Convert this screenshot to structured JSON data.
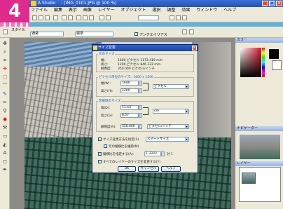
{
  "step": {
    "number": "4"
  },
  "app": {
    "title": "A Studio　 - [IMG_0101.JPG @ 100 %]"
  },
  "menu": [
    "ファイル",
    "編集",
    "表示",
    "画像",
    "レイヤー",
    "オブジェクト",
    "選択",
    "調整",
    "効果",
    "ウィンドウ",
    "ヘルプ"
  ],
  "toolbar2": {
    "mode_label": "スタイル",
    "mode_value": "通常",
    "style_value": "標準",
    "antialias_label": "アンチエイリアス"
  },
  "panels": {
    "color": "カラー",
    "navigator": "ナビゲーター",
    "layers": "レイヤー"
  },
  "dialog": {
    "title": "サイズ変更",
    "current_group": "元のサイズ",
    "current_rows": [
      {
        "label": "幅:",
        "value": "1600 ピクセル  1172.419 mm"
      },
      {
        "label": "高さ:",
        "value": "1200 ピクセル  846.333 mm"
      },
      {
        "label": "解像度:",
        "value": "350.000 ピクセル/インチ"
      }
    ],
    "pixel_group": "ピクセル単位のサイズ：1600 x 1200",
    "pixel_width_label": "幅(W):",
    "pixel_width_value": "1600",
    "pixel_height_label": "高さ(H):",
    "pixel_height_value": "1200",
    "pixel_unit": "ピクセル",
    "print_group": "印刷時のサイズ",
    "print_width_label": "幅(D):",
    "print_width_value": "11.43",
    "print_height_label": "高さ(G):",
    "print_height_value": "8.57",
    "print_unit": "cm",
    "resolution_label": "解像度(R):",
    "resolution_value": "350.000",
    "resolution_unit": "ピクセル/インチ",
    "resample_label": "サイズ変更方法を指定(S)",
    "resample_value": "スマートサイズ",
    "aspect_label": "元の縦横比を維持(M)",
    "ratio_label": "縦横比を指定する(A):",
    "ratio_value": "1.3333",
    "ratio_suffix": "対 1",
    "all_layers_label": "すべてのレイヤーのサイズを変更する(Y)",
    "ok": "OK",
    "cancel": "キャンセル",
    "help": "ヘルプ"
  }
}
